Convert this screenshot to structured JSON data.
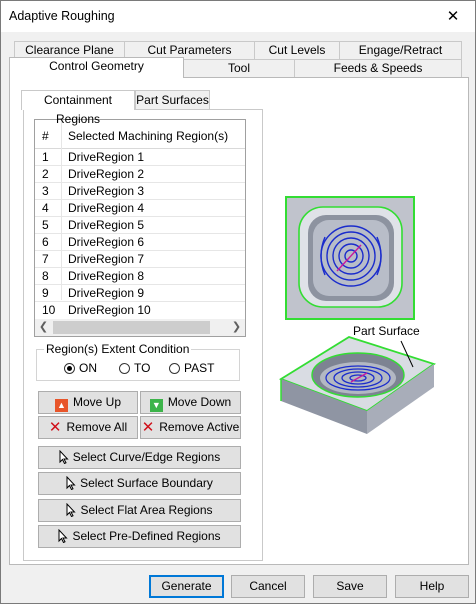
{
  "window": {
    "title": "Adaptive Roughing",
    "close_glyph": "✕"
  },
  "tabs_row1": [
    "Clearance Plane",
    "Cut Parameters",
    "Cut Levels",
    "Engage/Retract"
  ],
  "tabs_row2": [
    "Control Geometry",
    "Tool",
    "Feeds & Speeds"
  ],
  "active_tab": "Control Geometry",
  "subtabs": [
    "Containment Regions",
    "Part Surfaces"
  ],
  "active_subtab": "Containment Regions",
  "list": {
    "col_num": "#",
    "col_name": "Selected Machining Region(s)",
    "rows": [
      {
        "num": "1",
        "name": "DriveRegion 1"
      },
      {
        "num": "2",
        "name": "DriveRegion 2"
      },
      {
        "num": "3",
        "name": "DriveRegion 3"
      },
      {
        "num": "4",
        "name": "DriveRegion 4"
      },
      {
        "num": "5",
        "name": "DriveRegion 5"
      },
      {
        "num": "6",
        "name": "DriveRegion 6"
      },
      {
        "num": "7",
        "name": "DriveRegion 7"
      },
      {
        "num": "8",
        "name": "DriveRegion 8"
      },
      {
        "num": "9",
        "name": "DriveRegion 9"
      },
      {
        "num": "10",
        "name": "DriveRegion 10"
      }
    ]
  },
  "extent": {
    "legend": "Region(s) Extent Condition",
    "options": [
      "ON",
      "TO",
      "PAST"
    ],
    "selected": "ON"
  },
  "buttons": {
    "move_up": "Move Up",
    "move_down": "Move Down",
    "remove_all": "Remove All",
    "remove_active": "Remove Active",
    "select_curve": "Select Curve/Edge Regions",
    "select_surface": "Select Surface Boundary",
    "select_flat": "Select Flat Area Regions",
    "select_predef": "Select Pre-Defined Regions"
  },
  "preview": {
    "callout": "Part Surface"
  },
  "footer": {
    "generate": "Generate",
    "cancel": "Cancel",
    "save": "Save",
    "help": "Help"
  },
  "colors": {
    "accent_blue": "#0078d7",
    "region_green": "#33dd33",
    "toolpath_blue": "#1a2ccc",
    "toolpath_magenta": "#c8189c"
  }
}
